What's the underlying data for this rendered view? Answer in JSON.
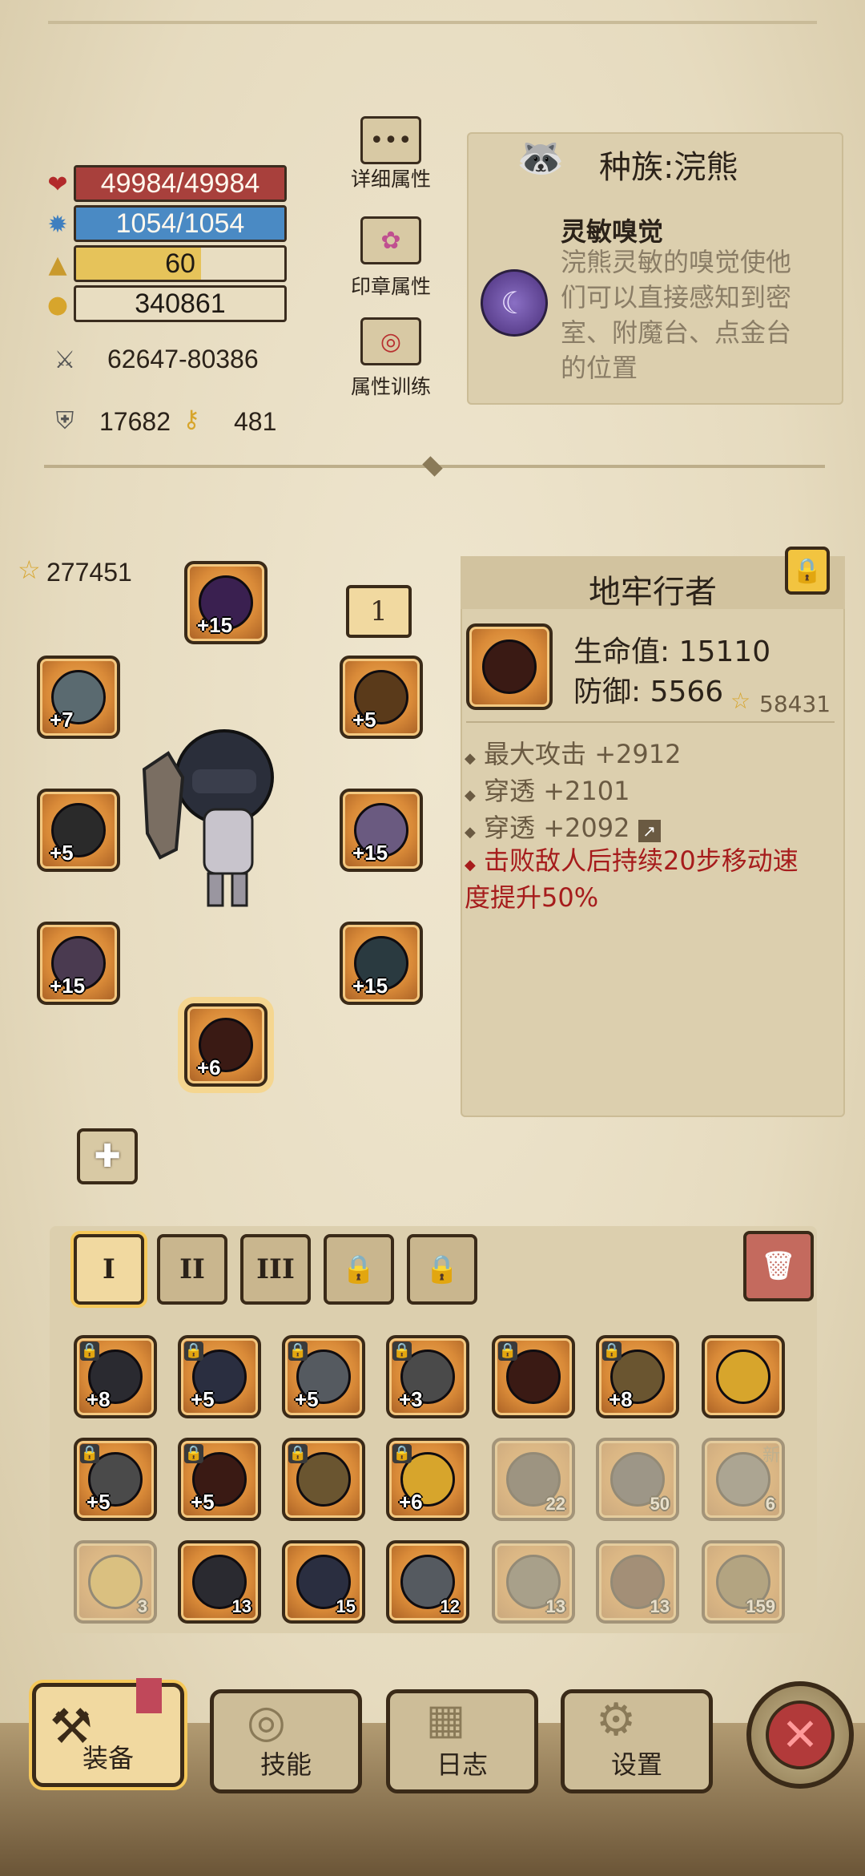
{
  "stats": {
    "hp": "49984/49984",
    "hp_fraction": 1.0,
    "mana": "1054/1054",
    "mana_fraction": 1.0,
    "level": "60",
    "level_fraction": 0.6,
    "gold": "340861",
    "attack": "62647-80386",
    "defense": "17682",
    "keys": "481"
  },
  "side_buttons": {
    "detail": "详细属性",
    "seal": "印章属性",
    "training": "属性训练"
  },
  "race": {
    "title": "种族:浣熊",
    "skill_name": "灵敏嗅觉",
    "skill_desc": "浣熊灵敏的嗅觉使他们可以直接感知到密室、附魔台、点金台的位置"
  },
  "equip": {
    "total_power": "277451",
    "page_num": "1",
    "slots": {
      "helmet": "+15",
      "ring": "+7",
      "necklace": "+5",
      "weapon": "+5",
      "shoulder": "+15",
      "glove": "+15",
      "armor": "+15",
      "boots": "+6"
    }
  },
  "item": {
    "name": "地牢行者",
    "hp_line": "生命值: 15110",
    "def_line": "防御: 5566",
    "score": "58431",
    "attrs": [
      "最大攻击 +2912",
      "穿透 +2101",
      "穿透 +2092"
    ],
    "special": "击败敌人后持续20步移动速度提升50%"
  },
  "bag": {
    "tabs": [
      "I",
      "II",
      "III"
    ],
    "rows": [
      [
        {
          "lvl": "+8",
          "lock": true
        },
        {
          "lvl": "+5",
          "lock": true
        },
        {
          "lvl": "+5",
          "lock": true
        },
        {
          "lvl": "+3",
          "lock": true
        },
        {
          "lvl": "",
          "lock": true
        },
        {
          "lvl": "+8",
          "lock": true
        },
        {
          "lvl": "",
          "lock": false
        }
      ],
      [
        {
          "lvl": "+5",
          "lock": true
        },
        {
          "lvl": "+5",
          "lock": true
        },
        {
          "lvl": "",
          "lock": true
        },
        {
          "lvl": "+6",
          "lock": true
        },
        {
          "cnt": "22",
          "dim": true
        },
        {
          "cnt": "50",
          "dim": true
        },
        {
          "cnt": "6",
          "dim": true,
          "new": "新"
        }
      ],
      [
        {
          "cnt": "3",
          "dim": true
        },
        {
          "cnt": "13"
        },
        {
          "cnt": "15"
        },
        {
          "cnt": "12"
        },
        {
          "cnt": "13",
          "dim": true
        },
        {
          "cnt": "13",
          "dim": true
        },
        {
          "cnt": "159",
          "dim": true
        }
      ]
    ]
  },
  "nav": {
    "equip": "装备",
    "skill": "技能",
    "log": "日志",
    "settings": "设置"
  }
}
